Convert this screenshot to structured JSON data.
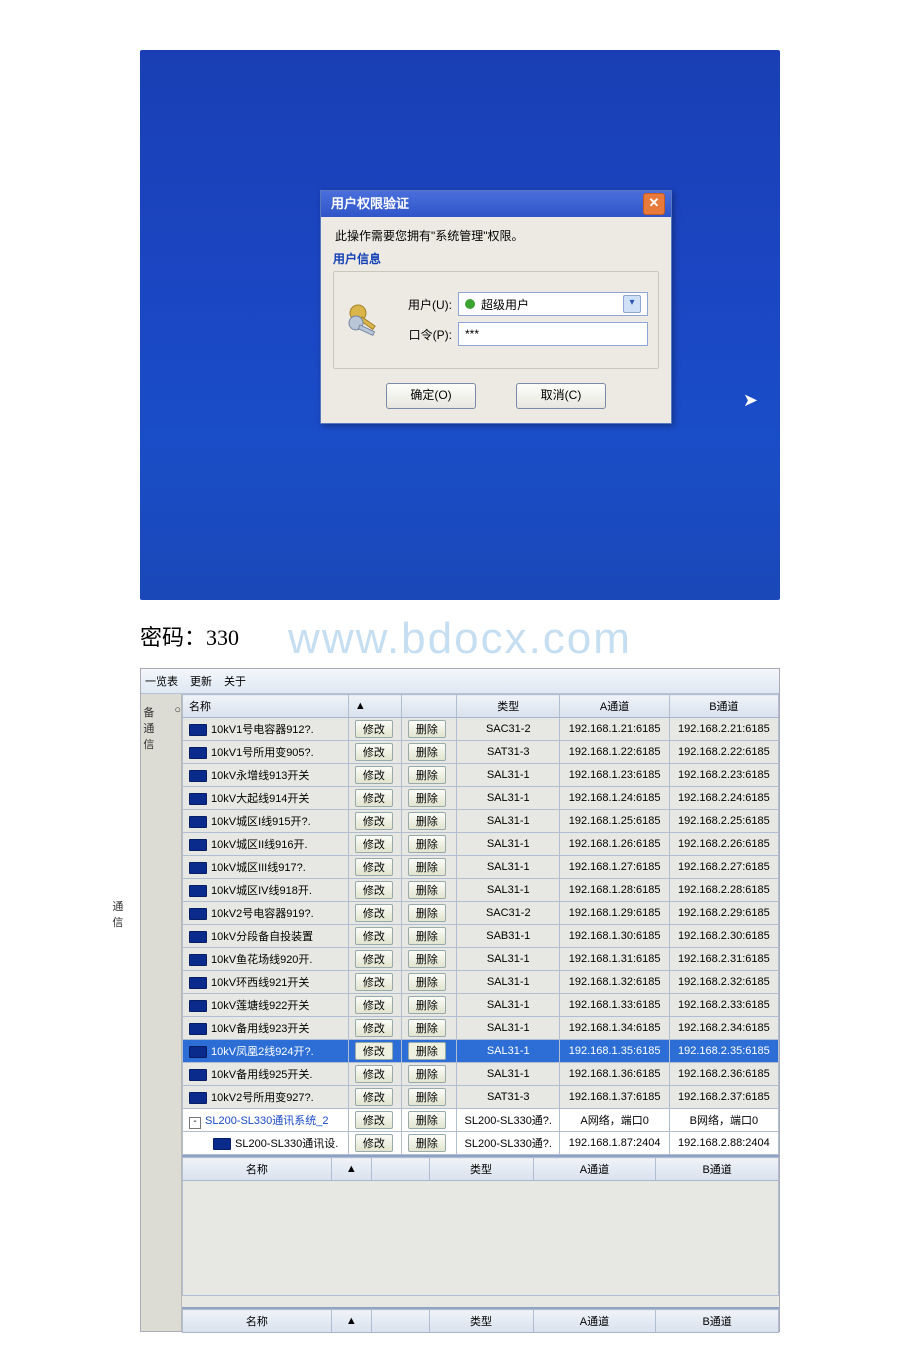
{
  "dialog": {
    "title": "用户权限验证",
    "message": "此操作需要您拥有\"系统管理\"权限。",
    "fieldset_title": "用户信息",
    "user_label": "用户(U):",
    "user_value": "超级用户",
    "pwd_label": "口令(P):",
    "pwd_value": "***",
    "ok": "确定(O)",
    "cancel": "取消(C)"
  },
  "caption": "密码：330",
  "watermark": "www.bdocx.com",
  "app": {
    "toolbar": {
      "list": "一览表",
      "refresh": "更新",
      "about": "关于"
    },
    "side": {
      "item1": "备通信",
      "item2": "通信"
    },
    "columns": {
      "name": "名称",
      "type": "类型",
      "a": "A通道",
      "b": "B通道"
    },
    "actions": {
      "edit": "修改",
      "del": "删除"
    },
    "rows": [
      {
        "name": "10kV1号电容器912?.",
        "type": "SAC31-2",
        "a": "192.168.1.21:6185",
        "b": "192.168.2.21:6185"
      },
      {
        "name": "10kV1号所用变905?.",
        "type": "SAT31-3",
        "a": "192.168.1.22:6185",
        "b": "192.168.2.22:6185"
      },
      {
        "name": "10kV永增线913开关",
        "type": "SAL31-1",
        "a": "192.168.1.23:6185",
        "b": "192.168.2.23:6185"
      },
      {
        "name": "10kV大起线914开关",
        "type": "SAL31-1",
        "a": "192.168.1.24:6185",
        "b": "192.168.2.24:6185"
      },
      {
        "name": "10kV城区I线915开?.",
        "type": "SAL31-1",
        "a": "192.168.1.25:6185",
        "b": "192.168.2.25:6185"
      },
      {
        "name": "10kV城区II线916开.",
        "type": "SAL31-1",
        "a": "192.168.1.26:6185",
        "b": "192.168.2.26:6185"
      },
      {
        "name": "10kV城区III线917?.",
        "type": "SAL31-1",
        "a": "192.168.1.27:6185",
        "b": "192.168.2.27:6185"
      },
      {
        "name": "10kV城区IV线918开.",
        "type": "SAL31-1",
        "a": "192.168.1.28:6185",
        "b": "192.168.2.28:6185"
      },
      {
        "name": "10kV2号电容器919?.",
        "type": "SAC31-2",
        "a": "192.168.1.29:6185",
        "b": "192.168.2.29:6185"
      },
      {
        "name": "10kV分段备自投装置",
        "type": "SAB31-1",
        "a": "192.168.1.30:6185",
        "b": "192.168.2.30:6185"
      },
      {
        "name": "10kV鱼花场线920开.",
        "type": "SAL31-1",
        "a": "192.168.1.31:6185",
        "b": "192.168.2.31:6185"
      },
      {
        "name": "10kV环西线921开关",
        "type": "SAL31-1",
        "a": "192.168.1.32:6185",
        "b": "192.168.2.32:6185"
      },
      {
        "name": "10kV莲塘线922开关",
        "type": "SAL31-1",
        "a": "192.168.1.33:6185",
        "b": "192.168.2.33:6185"
      },
      {
        "name": "10kV备用线923开关",
        "type": "SAL31-1",
        "a": "192.168.1.34:6185",
        "b": "192.168.2.34:6185"
      },
      {
        "name": "10kV凤凰2线924开?.",
        "type": "SAL31-1",
        "a": "192.168.1.35:6185",
        "b": "192.168.2.35:6185",
        "sel": true
      },
      {
        "name": "10kV备用线925开关.",
        "type": "SAL31-1",
        "a": "192.168.1.36:6185",
        "b": "192.168.2.36:6185"
      },
      {
        "name": "10kV2号所用变927?.",
        "type": "SAT31-3",
        "a": "192.168.1.37:6185",
        "b": "192.168.2.37:6185"
      }
    ],
    "tree_rows": [
      {
        "name": "SL200-SL330通讯系统_2",
        "type": "SL200-SL330通?.",
        "a": "A网络，端口0",
        "b": "B网络，端口0",
        "expander": true
      },
      {
        "name": "SL200-SL330通讯设.",
        "type": "SL200-SL330通?.",
        "a": "192.168.1.87:2404",
        "b": "192.168.2.88:2404"
      }
    ]
  }
}
